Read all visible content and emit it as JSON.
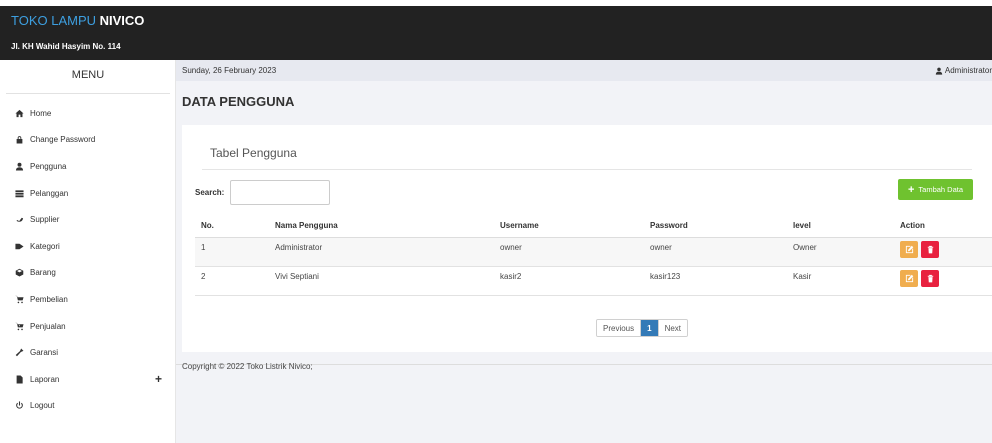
{
  "header": {
    "brand_accent": "TOKO LAMPU",
    "brand_main": "NIVICO",
    "address": "Jl. KH Wahid Hasyim No. 114"
  },
  "sidebar": {
    "title": "MENU",
    "items": [
      {
        "label": "Home",
        "icon": "home-icon"
      },
      {
        "label": "Change Password",
        "icon": "lock-icon"
      },
      {
        "label": "Pengguna",
        "icon": "user-icon"
      },
      {
        "label": "Pelanggan",
        "icon": "table-icon"
      },
      {
        "label": "Supplier",
        "icon": "phone-icon"
      },
      {
        "label": "Kategori",
        "icon": "tags-icon"
      },
      {
        "label": "Barang",
        "icon": "box-icon"
      },
      {
        "label": "Pembelian",
        "icon": "cart-icon"
      },
      {
        "label": "Penjualan",
        "icon": "cart-arrow-icon"
      },
      {
        "label": "Garansi",
        "icon": "wrench-icon"
      },
      {
        "label": "Laporan",
        "icon": "file-icon",
        "expand": "+"
      },
      {
        "label": "Logout",
        "icon": "power-icon"
      }
    ]
  },
  "infobar": {
    "date": "Sunday, 26 February 2023",
    "user": "Administrator"
  },
  "page": {
    "title": "DATA PENGGUNA"
  },
  "panel": {
    "title": "Tabel Pengguna",
    "search_label": "Search:",
    "search_value": "",
    "add_button": "Tambah Data",
    "columns": [
      "No.",
      "Nama Pengguna",
      "Username",
      "Password",
      "level",
      "Action"
    ],
    "rows": [
      [
        "1",
        "Administrator",
        "owner",
        "owner",
        "Owner"
      ],
      [
        "2",
        "Vivi Septiani",
        "kasir2",
        "kasir123",
        "Kasir"
      ]
    ],
    "pagination": {
      "previous": "Previous",
      "current": "1",
      "next": "Next"
    }
  },
  "footer": {
    "text": "Copyright © 2022 Toko Listrik Nivico;"
  },
  "colors": {
    "topbar": "#222222",
    "brand_accent": "#3d9fe0",
    "add_button": "#6fc22f",
    "edit_button": "#f0ad4e",
    "delete_button": "#e8213f",
    "page_active": "#337ab7"
  }
}
